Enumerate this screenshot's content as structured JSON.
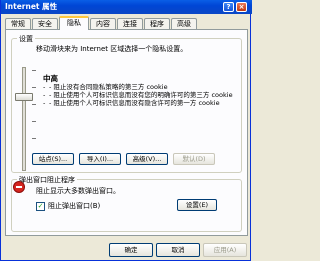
{
  "window": {
    "title": "Internet 属性",
    "help_glyph": "?",
    "close_glyph": "×"
  },
  "tabs": [
    {
      "label": "常规"
    },
    {
      "label": "安全"
    },
    {
      "label": "隐私"
    },
    {
      "label": "内容"
    },
    {
      "label": "连接"
    },
    {
      "label": "程序"
    },
    {
      "label": "高级"
    }
  ],
  "settings": {
    "group_label": "设置",
    "description": "移动滑块来为 Internet 区域选择一个隐私设置。",
    "level_title": "中高",
    "bullets": [
      "- 阻止没有合同隐私策略的第三方 cookie",
      "- 阻止使用个人可标识信息而没有您的明确许可的第三方 cookie",
      "- 阻止使用个人可标识信息而没有隐含许可的第一方 cookie"
    ],
    "buttons": {
      "sites": "站点(S)...",
      "import": "导入(I)...",
      "advanced": "高级(V)...",
      "default": "默认(D)"
    }
  },
  "popup": {
    "group_label": "弹出窗口阻止程序",
    "description": "阻止显示大多数弹出窗口。",
    "checkbox_label": "阻止弹出窗口(B)",
    "checkbox_checked": true,
    "settings_button": "设置(E)"
  },
  "footer": {
    "ok": "确定",
    "cancel": "取消",
    "apply": "应用(A)"
  },
  "colors": {
    "titlebar": "#0a5fe6",
    "tab_highlight": "#ffc83c",
    "button_border": "#003c74"
  }
}
